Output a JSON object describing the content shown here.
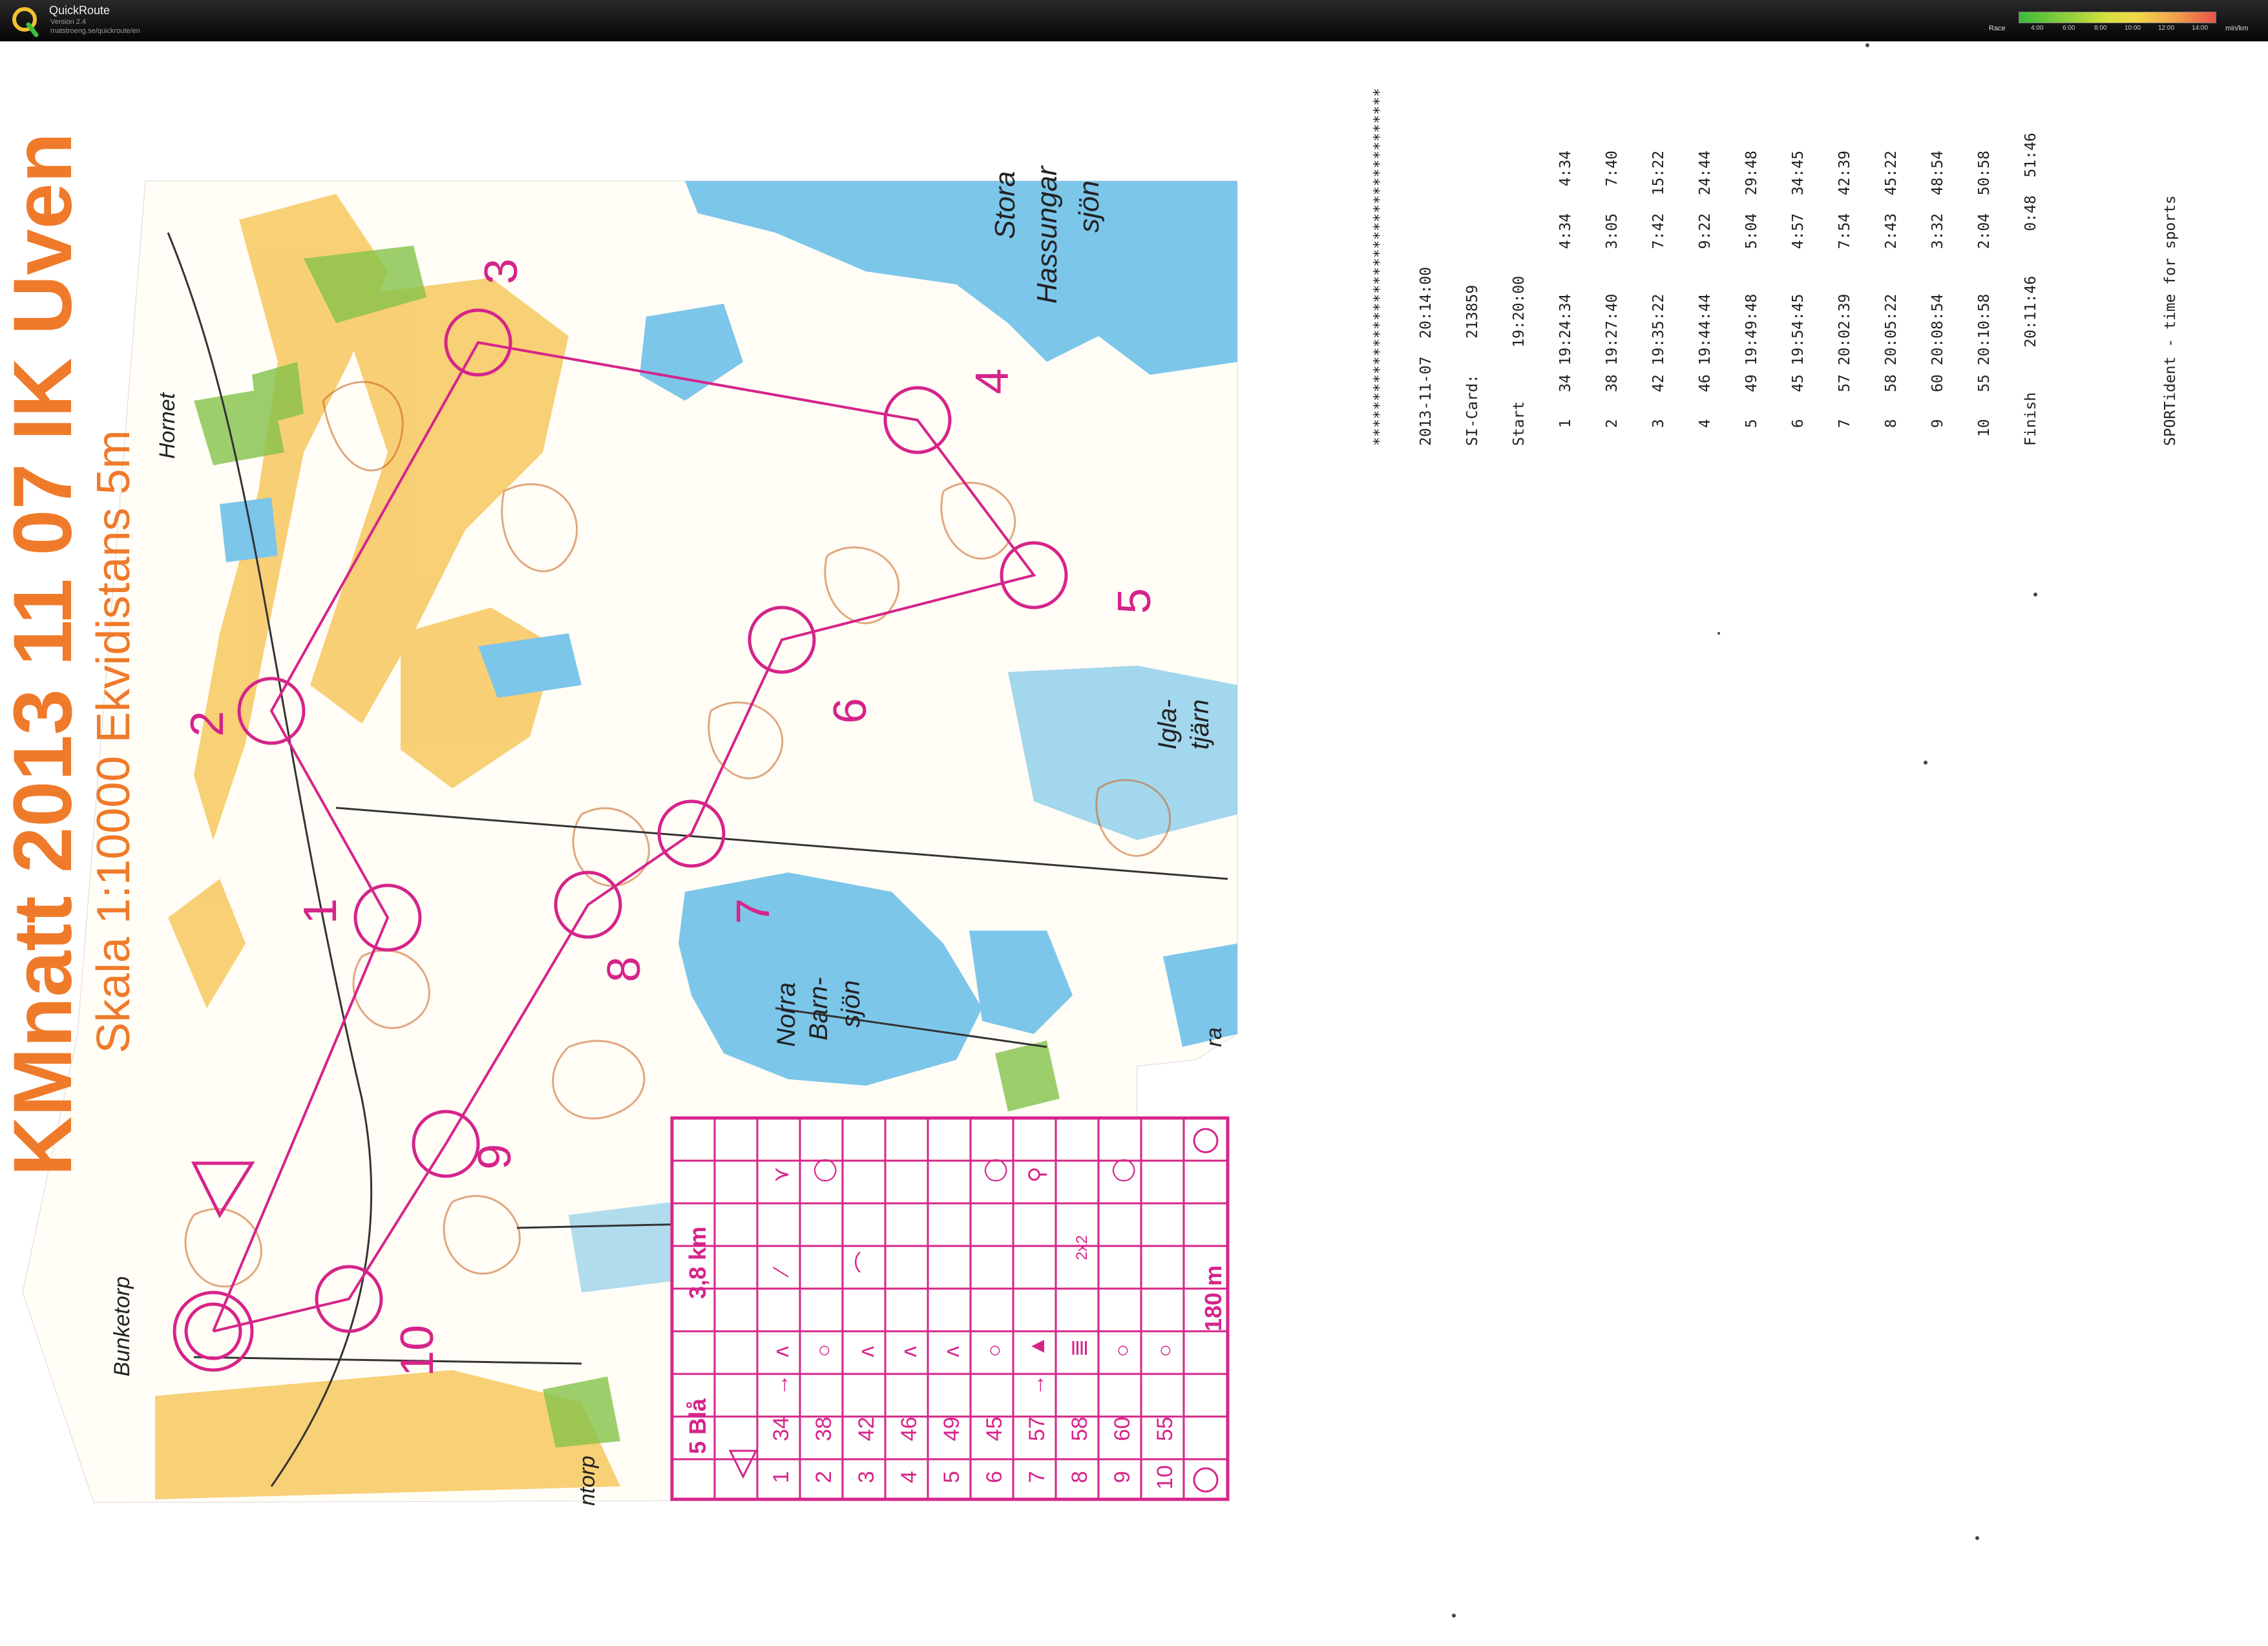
{
  "app": {
    "name": "QuickRoute",
    "version": "Version 2.4",
    "url": "matstroeng.se/quickroute/en"
  },
  "pace_legend": {
    "label": "Race",
    "ticks": [
      "4:00",
      "6:00",
      "8:00",
      "10:00",
      "12:00",
      "14:00"
    ],
    "unit": "min/km",
    "colors": [
      "#3dbb3a",
      "#8fcf3c",
      "#d7e13c",
      "#f1d74a",
      "#f1a04c",
      "#e5534a"
    ]
  },
  "map": {
    "title": "KMnatt 2013 11 07 IK Uven",
    "subtitle": "Skala 1:10000 Ekvidistans 5m",
    "place_names": [
      "Hornet",
      "Stora",
      "Hassungar",
      "sjön",
      "Igla-",
      "tjärn",
      "Norra",
      "Barn-",
      "sjön",
      "Bunketorp",
      "ntorp",
      "ra"
    ],
    "control_numbers": [
      "1",
      "2",
      "3",
      "4",
      "5",
      "6",
      "7",
      "8",
      "9",
      "10"
    ],
    "colors": {
      "course": "#d6248a",
      "title": "#ef7a2a",
      "water": "#7cc6ea",
      "contour": "#c8611c",
      "open": "#f6c04a",
      "green": "#84c24a"
    }
  },
  "control_card": {
    "course": "5 Blå",
    "length": "3,8 km",
    "climb": "180 m",
    "rows": [
      {
        "n": "1",
        "code": "34",
        "feature": "→",
        "sym": "ʌ",
        "extra": "⁄",
        "loc": "⋎"
      },
      {
        "n": "2",
        "code": "38",
        "feature": "",
        "sym": "○",
        "extra": "",
        "loc": "◯"
      },
      {
        "n": "3",
        "code": "42",
        "feature": "",
        "sym": "ʌ",
        "extra": "⌒",
        "loc": ""
      },
      {
        "n": "4",
        "code": "46",
        "feature": "",
        "sym": "ʌ",
        "extra": "",
        "loc": ""
      },
      {
        "n": "5",
        "code": "49",
        "feature": "",
        "sym": "ʌ",
        "extra": "",
        "loc": ""
      },
      {
        "n": "6",
        "code": "45",
        "feature": "",
        "sym": "○",
        "extra": "",
        "loc": "◯"
      },
      {
        "n": "7",
        "code": "57",
        "feature": "→",
        "sym": "▲",
        "extra": "",
        "loc": "⚲"
      },
      {
        "n": "8",
        "code": "58",
        "feature": "",
        "sym": "≣",
        "extra": "2x2",
        "loc": ""
      },
      {
        "n": "9",
        "code": "60",
        "feature": "",
        "sym": "○",
        "extra": "",
        "loc": "◯"
      },
      {
        "n": "10",
        "code": "55",
        "feature": "",
        "sym": "○",
        "extra": "",
        "loc": ""
      }
    ]
  },
  "receipt": {
    "stars": "****************************************",
    "date_line": "2013-11-07  20:14:00",
    "card_line": "SI-Card:    213859",
    "start_line": "Start      19:20:00",
    "splits": [
      "  1   34 19:24:34     4:34   4:34",
      "  2   38 19:27:40     3:05   7:40",
      "  3   42 19:35:22     7:42  15:22",
      "  4   46 19:44:44     9:22  24:44",
      "  5   49 19:49:48     5:04  29:48",
      "  6   45 19:54:45     4:57  34:45",
      "  7   57 20:02:39     7:54  42:39",
      "  8   58 20:05:22     2:43  45:22",
      "  9   60 20:08:54     3:32  48:54",
      " 10   55 20:10:58     2:04  50:58"
    ],
    "finish_line": "Finish     20:11:46     0:48  51:46",
    "footer": "SPORTident - time for sports"
  }
}
